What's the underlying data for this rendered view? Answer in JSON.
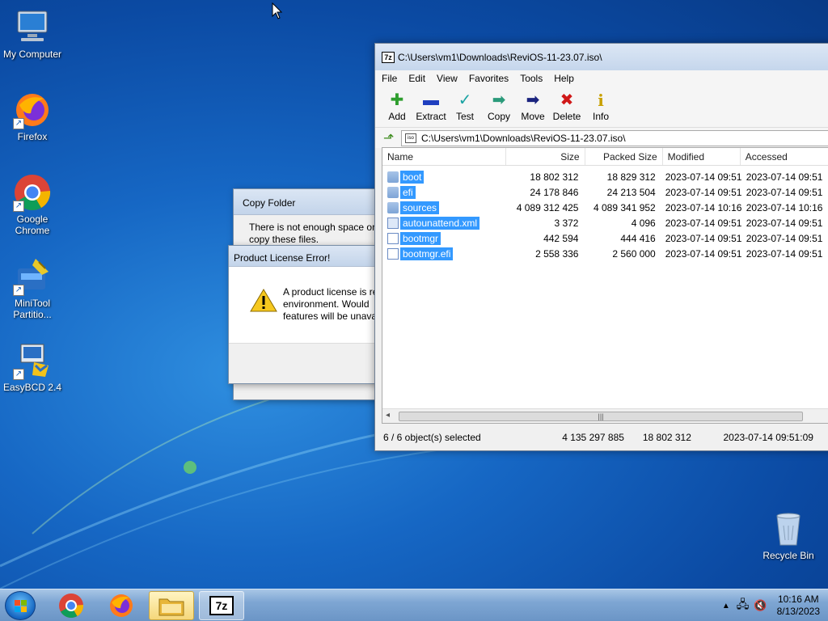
{
  "desktop": {
    "icons": [
      {
        "label": "My Computer"
      },
      {
        "label": "Firefox"
      },
      {
        "label": "Google Chrome"
      },
      {
        "label": "MiniTool Partitio..."
      },
      {
        "label": "EasyBCD 2.4"
      },
      {
        "label": "Recycle Bin"
      }
    ]
  },
  "copy_dialog": {
    "title": "Copy Folder",
    "message_line1": "There is not enough space on",
    "message_line2": "copy these files."
  },
  "license_dialog": {
    "title": "Product License Error!",
    "line1": "A product license is re",
    "line2": "environment. Would",
    "line3": "features will be unava"
  },
  "sevenzip": {
    "title": "C:\\Users\\vm1\\Downloads\\ReviOS-11-23.07.iso\\",
    "menu": [
      "File",
      "Edit",
      "View",
      "Favorites",
      "Tools",
      "Help"
    ],
    "toolbar": [
      {
        "label": "Add",
        "icon": "plus-icon",
        "glyph": "✚",
        "color": "#2e9e2e"
      },
      {
        "label": "Extract",
        "icon": "minus-icon",
        "glyph": "▬",
        "color": "#1f3fbf"
      },
      {
        "label": "Test",
        "icon": "check-icon",
        "glyph": "✓",
        "color": "#1aa3a3"
      },
      {
        "label": "Copy",
        "icon": "copy-arrow-icon",
        "glyph": "➡",
        "color": "#2a9a7a"
      },
      {
        "label": "Move",
        "icon": "move-arrow-icon",
        "glyph": "➡",
        "color": "#1a237e"
      },
      {
        "label": "Delete",
        "icon": "delete-x-icon",
        "glyph": "✖",
        "color": "#d01818"
      },
      {
        "label": "Info",
        "icon": "info-icon",
        "glyph": "i",
        "color": "#c8a000"
      }
    ],
    "address": "C:\\Users\\vm1\\Downloads\\ReviOS-11-23.07.iso\\",
    "columns": {
      "name": "Name",
      "size": "Size",
      "packed": "Packed Size",
      "modified": "Modified",
      "accessed": "Accessed"
    },
    "rows": [
      {
        "name": "boot",
        "type": "folder",
        "size": "18 802 312",
        "packed": "18 829 312",
        "modified": "2023-07-14 09:51",
        "accessed": "2023-07-14 09:51"
      },
      {
        "name": "efi",
        "type": "folder",
        "size": "24 178 846",
        "packed": "24 213 504",
        "modified": "2023-07-14 09:51",
        "accessed": "2023-07-14 09:51"
      },
      {
        "name": "sources",
        "type": "folder",
        "size": "4 089 312 425",
        "packed": "4 089 341 952",
        "modified": "2023-07-14 10:16",
        "accessed": "2023-07-14 10:16"
      },
      {
        "name": "autounattend.xml",
        "type": "xml",
        "size": "3 372",
        "packed": "4 096",
        "modified": "2023-07-14 09:51",
        "accessed": "2023-07-14 09:51"
      },
      {
        "name": "bootmgr",
        "type": "file",
        "size": "442 594",
        "packed": "444 416",
        "modified": "2023-07-14 09:51",
        "accessed": "2023-07-14 09:51"
      },
      {
        "name": "bootmgr.efi",
        "type": "file",
        "size": "2 558 336",
        "packed": "2 560 000",
        "modified": "2023-07-14 09:51",
        "accessed": "2023-07-14 09:51"
      }
    ],
    "status": {
      "selected": "6 / 6 object(s) selected",
      "total_size": "4 135 297 885",
      "packed": "18 802 312",
      "date": "2023-07-14 09:51:09"
    }
  },
  "taskbar": {
    "clock_time": "10:16 AM",
    "clock_date": "8/13/2023"
  }
}
